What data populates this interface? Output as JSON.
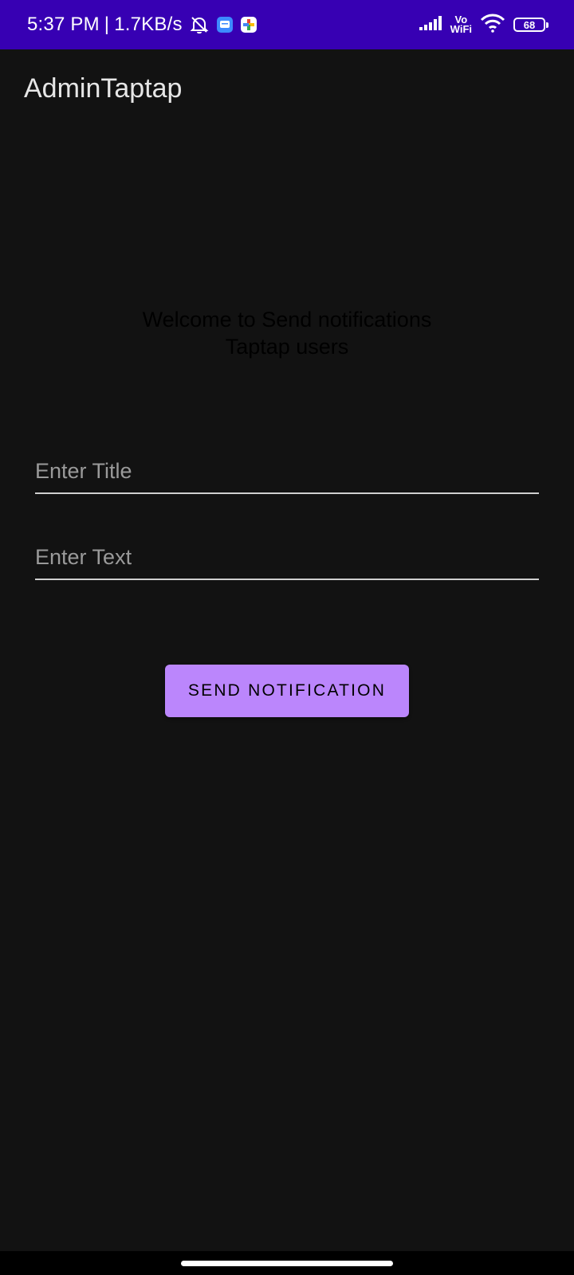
{
  "status_bar": {
    "time": "5:37 PM",
    "separator": "|",
    "speed": "1.7KB/s",
    "vo_label": "Vo",
    "wifi_label": "WiFi",
    "battery_level": "68",
    "icons": [
      "bell-off-icon",
      "message-app-icon",
      "photos-app-icon",
      "signal-icon",
      "wifi-icon",
      "battery-icon"
    ],
    "colors": {
      "background": "#3700b3"
    }
  },
  "app_bar": {
    "title": "AdminTaptap"
  },
  "main": {
    "welcome_line1": "Welcome to Send notifications",
    "welcome_line2": "Taptap users",
    "title_input": {
      "placeholder": "Enter Title",
      "value": ""
    },
    "text_input": {
      "placeholder": "Enter Text",
      "value": ""
    },
    "send_button_label": "SEND NOTIFICATION"
  },
  "colors": {
    "background": "#121212",
    "accent": "#bb86fc",
    "status_bar": "#3700b3"
  }
}
